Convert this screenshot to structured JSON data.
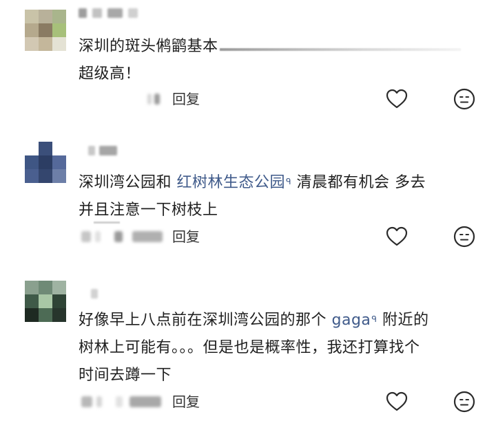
{
  "colors": {
    "text": "#1f1f1f",
    "link": "#3f5a8a",
    "icon_stroke": "#2b2b2b",
    "reply_text": "#333333",
    "background": "#ffffff"
  },
  "comments": [
    {
      "avatar_icon": "pixelated-avatar",
      "lines": [
        {
          "text": "深圳的斑头鸺鹠基本"
        },
        {
          "text": "超级高！"
        }
      ],
      "reply_label": "回复",
      "like_icon": "heart-outline-icon",
      "dislike_icon": "neutral-face-icon"
    },
    {
      "avatar_icon": "pixelated-avatar",
      "lines": [
        {
          "before": "深圳湾公园和 ",
          "link": "红树林生态公园",
          "link_mark": "ᑫ",
          "after": " 清晨都有机会 多去"
        },
        {
          "text": "并且注意一下树枝上"
        }
      ],
      "reply_label": "回复",
      "like_icon": "heart-outline-icon",
      "dislike_icon": "neutral-face-icon"
    },
    {
      "avatar_icon": "pixelated-avatar",
      "lines": [
        {
          "before": "好像早上八点前在深圳湾公园的那个 ",
          "link": "gaga",
          "link_mark": "ᑫ",
          "after": " 附近的"
        },
        {
          "text": "树林上可能有。。。但是也是概率性，我还打算找个"
        },
        {
          "text": "时间去蹲一下"
        }
      ],
      "reply_label": "回复",
      "like_icon": "heart-outline-icon",
      "dislike_icon": "neutral-face-icon"
    }
  ]
}
